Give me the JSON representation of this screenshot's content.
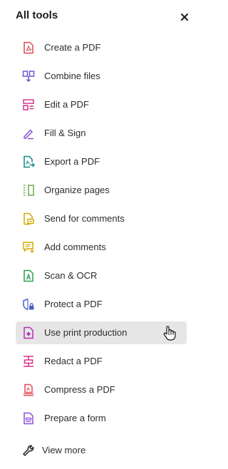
{
  "panel": {
    "title": "All tools",
    "close_icon": "close-icon"
  },
  "tools": [
    {
      "label": "Create a PDF",
      "icon": "create-pdf-icon",
      "color": "#e34850"
    },
    {
      "label": "Combine files",
      "icon": "combine-files-icon",
      "color": "#6e56cf"
    },
    {
      "label": "Edit a PDF",
      "icon": "edit-pdf-icon",
      "color": "#d6338a"
    },
    {
      "label": "Fill & Sign",
      "icon": "fill-sign-icon",
      "color": "#8a4fd8"
    },
    {
      "label": "Export a PDF",
      "icon": "export-pdf-icon",
      "color": "#0f8a8a"
    },
    {
      "label": "Organize pages",
      "icon": "organize-pages-icon",
      "color": "#6aa84f"
    },
    {
      "label": "Send for comments",
      "icon": "send-for-comments-icon",
      "color": "#d4a800"
    },
    {
      "label": "Add comments",
      "icon": "add-comments-icon",
      "color": "#d4a800"
    },
    {
      "label": "Scan & OCR",
      "icon": "scan-ocr-icon",
      "color": "#2e9e4f"
    },
    {
      "label": "Protect a PDF",
      "icon": "protect-pdf-icon",
      "color": "#4b5fc9"
    },
    {
      "label": "Use print production",
      "icon": "print-production-icon",
      "color": "#b530b5"
    },
    {
      "label": "Redact a PDF",
      "icon": "redact-pdf-icon",
      "color": "#d6338a"
    },
    {
      "label": "Compress a PDF",
      "icon": "compress-pdf-icon",
      "color": "#e34850"
    },
    {
      "label": "Prepare a form",
      "icon": "prepare-form-icon",
      "color": "#8a4fd8"
    }
  ],
  "view_more": {
    "label": "View more",
    "icon": "wrench-icon"
  },
  "active_item": "Use print production",
  "cursor_icon": "hand-pointer-icon"
}
